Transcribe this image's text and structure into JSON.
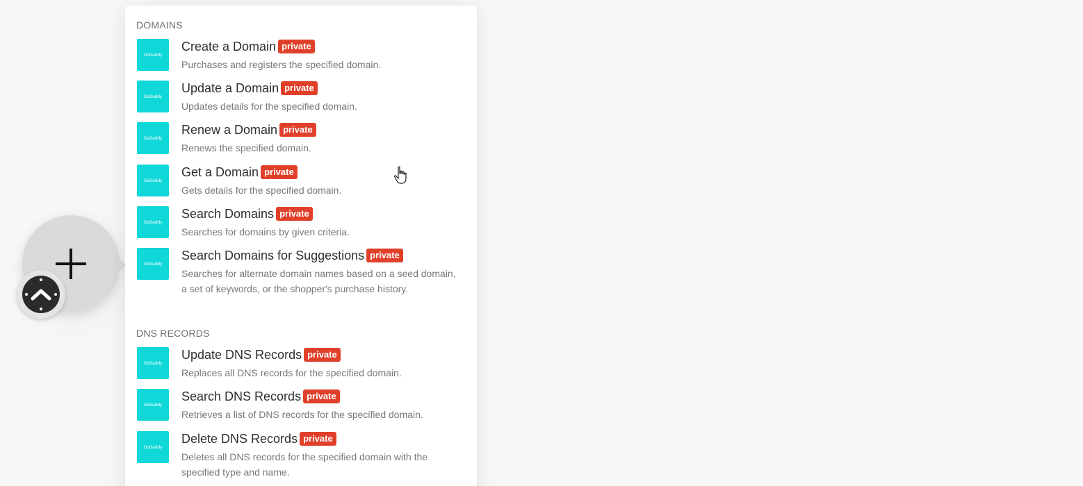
{
  "sections": [
    {
      "title": "DOMAINS",
      "items": [
        {
          "title": "Create a Domain",
          "badge": "private",
          "description": "Purchases and registers the specified domain.",
          "icon": "godaddy-logo-icon"
        },
        {
          "title": "Update a Domain",
          "badge": "private",
          "description": "Updates details for the specified domain.",
          "icon": "godaddy-logo-icon"
        },
        {
          "title": "Renew a Domain",
          "badge": "private",
          "description": "Renews the specified domain.",
          "icon": "godaddy-logo-icon"
        },
        {
          "title": "Get a Domain",
          "badge": "private",
          "description": "Gets details for the specified domain.",
          "icon": "godaddy-logo-icon"
        },
        {
          "title": "Search Domains",
          "badge": "private",
          "description": "Searches for domains by given criteria.",
          "icon": "godaddy-logo-icon"
        },
        {
          "title": "Search Domains for Suggestions",
          "badge": "private",
          "description": "Searches for alternate domain names based on a seed domain, a set of keywords, or the shopper's purchase history.",
          "icon": "godaddy-logo-icon"
        }
      ]
    },
    {
      "title": "DNS RECORDS",
      "items": [
        {
          "title": "Update DNS Records",
          "badge": "private",
          "description": "Replaces all DNS records for the specified domain.",
          "icon": "godaddy-logo-icon"
        },
        {
          "title": "Search DNS Records",
          "badge": "private",
          "description": "Retrieves a list of DNS records for the specified domain.",
          "icon": "godaddy-logo-icon"
        },
        {
          "title": "Delete DNS Records",
          "badge": "private",
          "description": "Deletes all DNS records for the specified domain with the specified type and name.",
          "icon": "godaddy-logo-icon"
        }
      ]
    }
  ],
  "icon_logo_text": "GoDaddy",
  "module": {
    "icon": "plus-icon",
    "trigger_icon": "clock-icon"
  },
  "colors": {
    "brand_icon_bg": "#10d8d8",
    "badge_bg": "#e0402a",
    "module_bg": "#dadada"
  }
}
